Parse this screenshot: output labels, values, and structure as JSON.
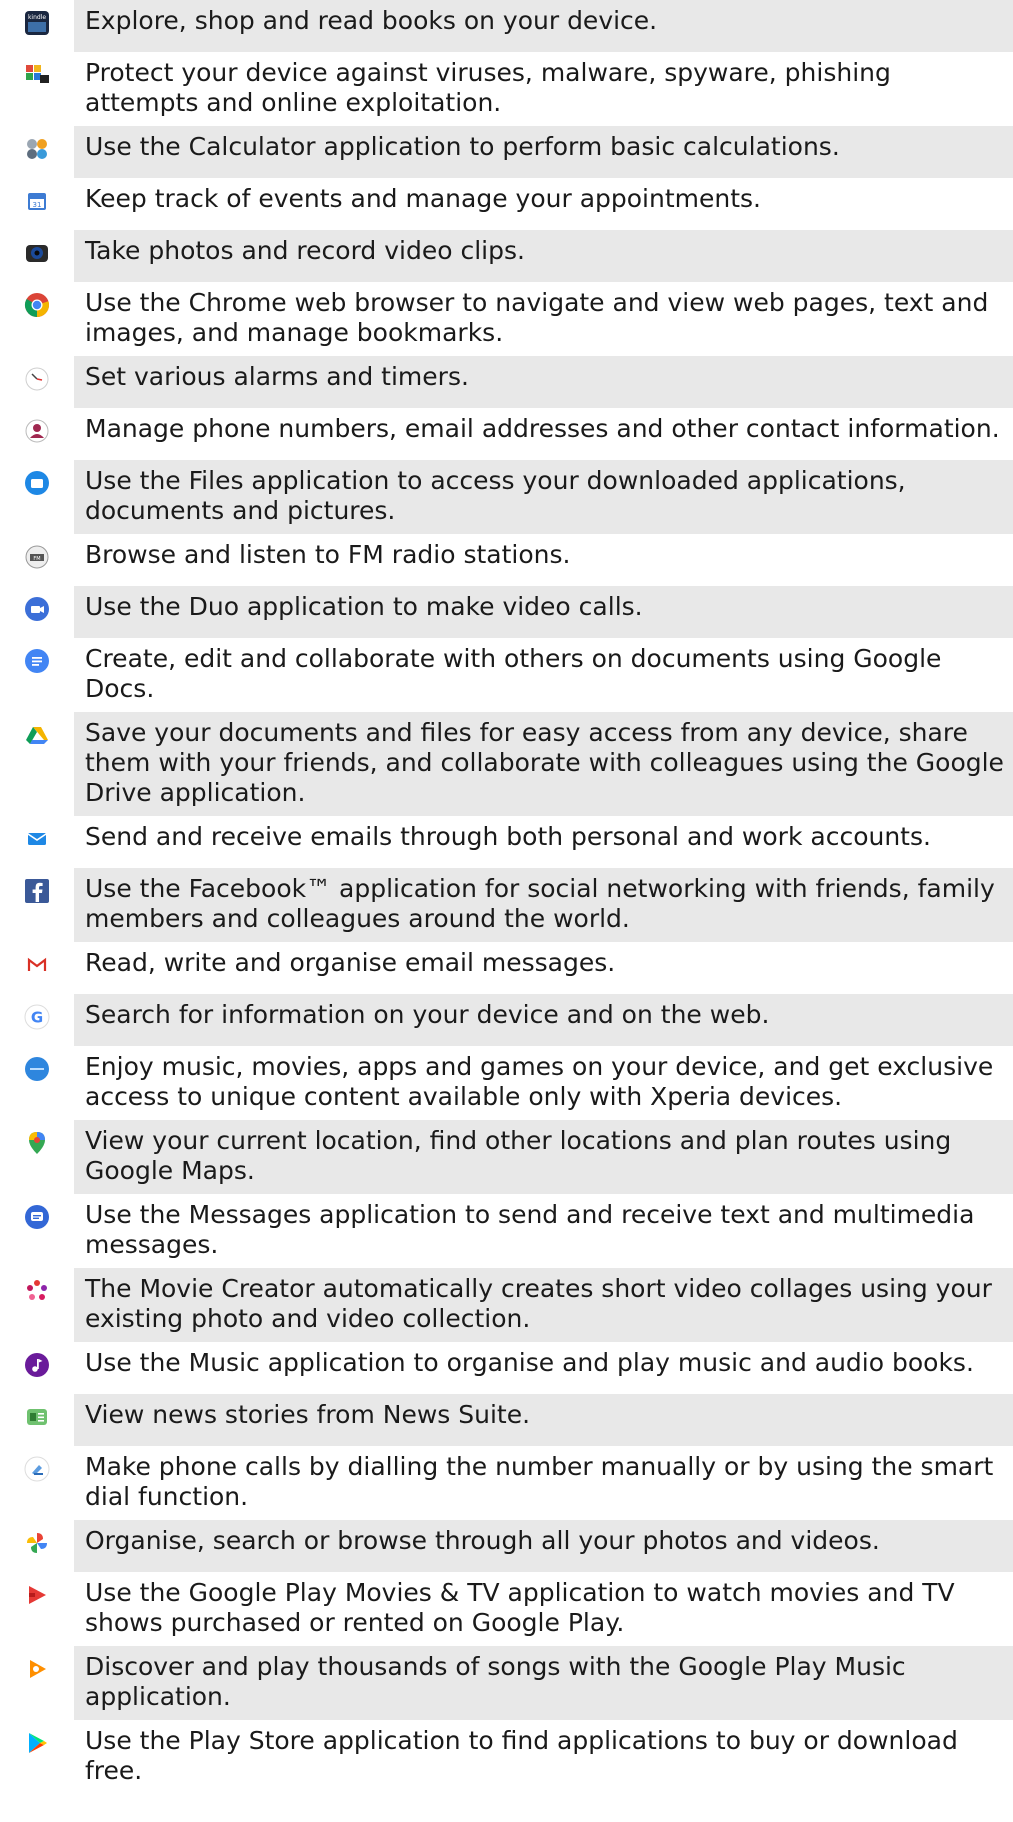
{
  "rows": [
    {
      "icon": "kindle-icon",
      "text": "Explore, shop and read books on your device.",
      "shaded": true
    },
    {
      "icon": "antivirus-icon",
      "text": "Protect your device against viruses, malware, spyware, phishing attempts and online exploitation.",
      "shaded": false
    },
    {
      "icon": "calculator-icon",
      "text": "Use the Calculator application to perform basic calculations.",
      "shaded": true
    },
    {
      "icon": "calendar-icon",
      "text": "Keep track of events and manage your appointments.",
      "shaded": false
    },
    {
      "icon": "camera-icon",
      "text": "Take photos and record video clips.",
      "shaded": true
    },
    {
      "icon": "chrome-icon",
      "text": "Use the Chrome web browser to navigate and view web pages, text and images, and manage bookmarks.",
      "shaded": false
    },
    {
      "icon": "clock-icon",
      "text": "Set various alarms and timers.",
      "shaded": true
    },
    {
      "icon": "contacts-icon",
      "text": "Manage phone numbers, email addresses and other contact information.",
      "shaded": false
    },
    {
      "icon": "files-icon",
      "text": "Use the Files application to access your downloaded applications, documents and pictures.",
      "shaded": true
    },
    {
      "icon": "fm-radio-icon",
      "text": "Browse and listen to FM radio stations.",
      "shaded": false
    },
    {
      "icon": "duo-icon",
      "text": "Use the Duo application to make video calls.",
      "shaded": true
    },
    {
      "icon": "docs-icon",
      "text": "Create, edit and collaborate with others on documents using Google Docs.",
      "shaded": false
    },
    {
      "icon": "drive-icon",
      "text": "Save your documents and files for easy access from any device, share them with your friends, and collaborate with colleagues using the Google Drive application.",
      "shaded": true
    },
    {
      "icon": "email-icon",
      "text": "Send and receive emails through both personal and work accounts.",
      "shaded": false
    },
    {
      "icon": "facebook-icon",
      "text": "Use the Facebook™ application for social networking with friends, family members and colleagues around the world.",
      "shaded": true
    },
    {
      "icon": "gmail-icon",
      "text": "Read, write and organise email messages.",
      "shaded": false
    },
    {
      "icon": "google-icon",
      "text": "Search for information on your device and on the web.",
      "shaded": true
    },
    {
      "icon": "xperia-lounge-icon",
      "text": "Enjoy music, movies, apps and games on your device, and get exclusive access to unique content available only with Xperia devices.",
      "shaded": false
    },
    {
      "icon": "maps-icon",
      "text": "View your current location, find other locations and plan routes using Google Maps.",
      "shaded": true
    },
    {
      "icon": "messages-icon",
      "text": "Use the Messages application to send and receive text and multimedia messages.",
      "shaded": false
    },
    {
      "icon": "movie-creator-icon",
      "text": "The Movie Creator automatically creates short video collages using your existing photo and video collection.",
      "shaded": true
    },
    {
      "icon": "music-icon",
      "text": "Use the Music application to organise and play music and audio books.",
      "shaded": false
    },
    {
      "icon": "news-suite-icon",
      "text": "View news stories from News Suite.",
      "shaded": true
    },
    {
      "icon": "phone-icon",
      "text": "Make phone calls by dialling the number manually or by using the smart dial function.",
      "shaded": false
    },
    {
      "icon": "photos-icon",
      "text": "Organise, search or browse through all your photos and videos.",
      "shaded": true
    },
    {
      "icon": "play-movies-icon",
      "text": "Use the Google Play Movies & TV application to watch movies and TV shows purchased or rented on Google Play.",
      "shaded": false
    },
    {
      "icon": "play-music-icon",
      "text": "Discover and play thousands of songs with the Google Play Music application.",
      "shaded": true
    },
    {
      "icon": "play-store-icon",
      "text": "Use the Play Store application to find applications to buy or download free.",
      "shaded": false
    }
  ]
}
